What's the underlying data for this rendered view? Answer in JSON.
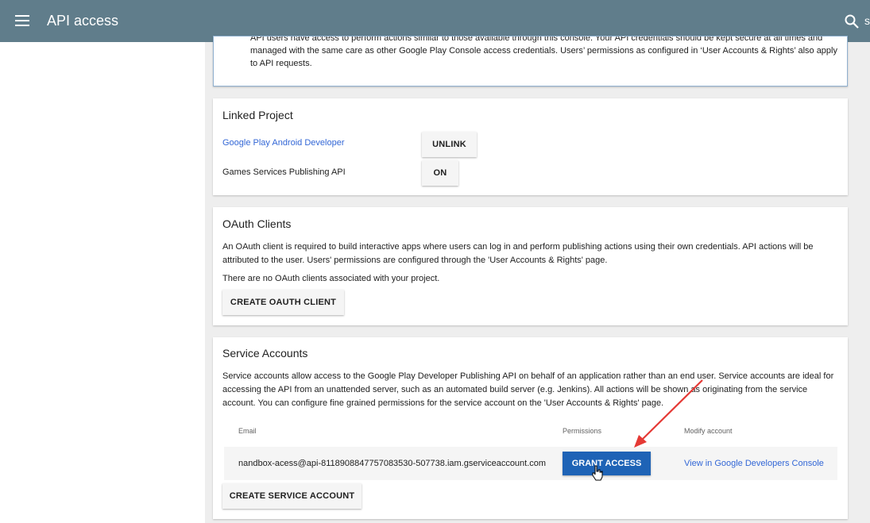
{
  "header": {
    "title": "API access",
    "search_partial": "s"
  },
  "intro": {
    "text": "API users have access to perform actions similar to those available through this console. Your API credentials should be kept secure at all times and managed with the same care as other Google Play Console access credentials. Users’ permissions as configured in ‘User Accounts & Rights’ also apply to API requests."
  },
  "linked_project": {
    "title": "Linked Project",
    "rows": [
      {
        "label": "Google Play Android Developer",
        "button": "UNLINK"
      },
      {
        "label": "Games Services Publishing API",
        "button": "ON"
      }
    ]
  },
  "oauth": {
    "title": "OAuth Clients",
    "description": "An OAuth client is required to build interactive apps where users can log in and perform publishing actions using their own credentials. API actions will be attributed to the user. Users' permissions are configured through the 'User Accounts & Rights' page.",
    "empty_text": "There are no OAuth clients associated with your project.",
    "create_button": "CREATE OAUTH CLIENT"
  },
  "service_accounts": {
    "title": "Service Accounts",
    "description": "Service accounts allow access to the Google Play Developer Publishing API on behalf of an application rather than an end user. Service accounts are ideal for accessing the API from an unattended server, such as an automated build server (e.g. Jenkins). All actions will be shown as originating from the service account. You can configure fine grained permissions for the service account on the 'User Accounts & Rights' page.",
    "columns": [
      "Email",
      "Permissions",
      "Modify account"
    ],
    "rows": [
      {
        "email": "nandbox-acess@api-8118908847757083530-507738.iam.gserviceaccount.com",
        "permissions_button": "GRANT ACCESS",
        "modify_link": "View in Google Developers Console"
      }
    ],
    "create_button": "CREATE SERVICE ACCOUNT"
  },
  "colors": {
    "topbar": "#607d8b",
    "primary_button": "#1e63b6",
    "link": "#3367d6",
    "annotation_arrow": "#e53935"
  },
  "icons": [
    "menu-icon",
    "search-icon",
    "pointer-cursor-icon"
  ]
}
